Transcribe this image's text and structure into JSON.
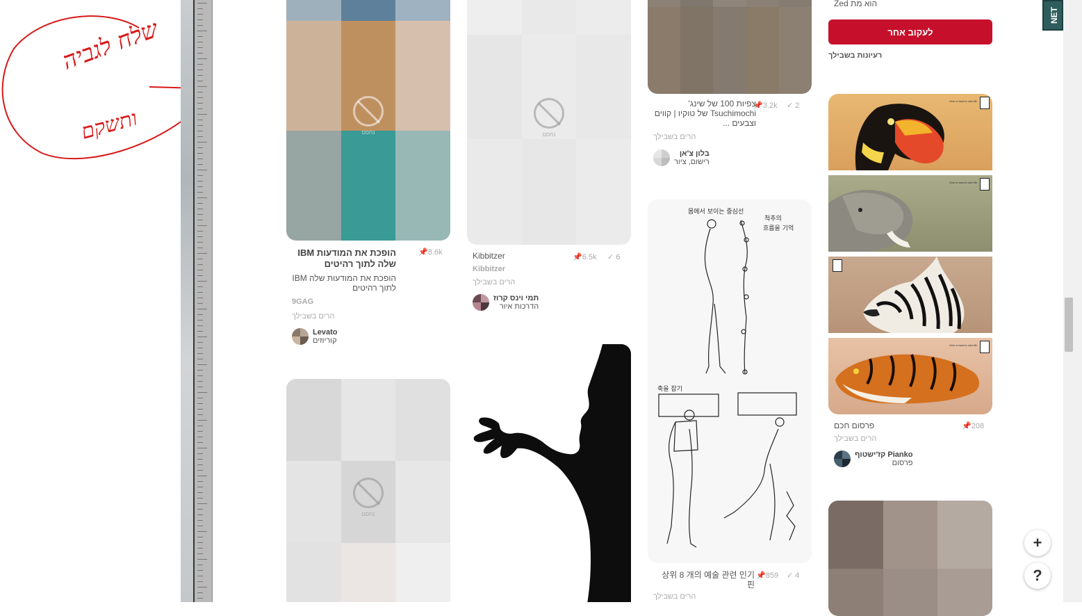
{
  "annotation": {
    "handwriting_line1": "שלח לגביה",
    "handwriting_line2": "ותשקם"
  },
  "top_user": {
    "follow_text": "הוא מת Zed"
  },
  "follow_button": {
    "label": "לעקוב אחר"
  },
  "ideas_label": "רעיונות בשבילך",
  "blocked_label": "נחסם",
  "pins": {
    "ibm": {
      "title": "הופכת את המודעות IBM שלה לתוך רהיטים",
      "description": "הופכת את המודעות שלה IBM לתוך רהיטים",
      "source": "9GAG",
      "via": "הרים בשבילך",
      "saves": "8.6k",
      "user_name": "Levato",
      "user_board": "קוריוזים"
    },
    "kibbitzer": {
      "title": "Kibbitzer",
      "source": "Kibbitzer",
      "via": "הרים בשבילך",
      "saves": "6.5k",
      "tries": "6",
      "user_name": "תמי וינס קרוז",
      "user_board": "הדרכות איור"
    },
    "tsuchimochi": {
      "title": "צפיות 100 של שינג' Tsuchimochi של טוקיו | קווים וצבעים ...",
      "via": "הרים בשבילך",
      "saves": "3.2k",
      "tries": "2",
      "user_name": "בלון צ'אן",
      "user_board": "רישום, ציור"
    },
    "korean": {
      "title": "상위 8 개의 예술 관련 인기 핀",
      "via": "הרים בשבילך",
      "saves": "859",
      "tries": "4"
    },
    "wwf": {
      "title": "פרסום חכם",
      "via": "הרים בשבילך",
      "saves": "208",
      "user_name": "Pianko קז'ישטוף",
      "user_board": "פרסום",
      "tagline": "Give a hand to wild life"
    }
  },
  "net_tab": "NET",
  "fab_add": "+",
  "fab_help": "?",
  "colors": {
    "follow_red": "#c6102b",
    "annotation_red": "#d81818"
  }
}
